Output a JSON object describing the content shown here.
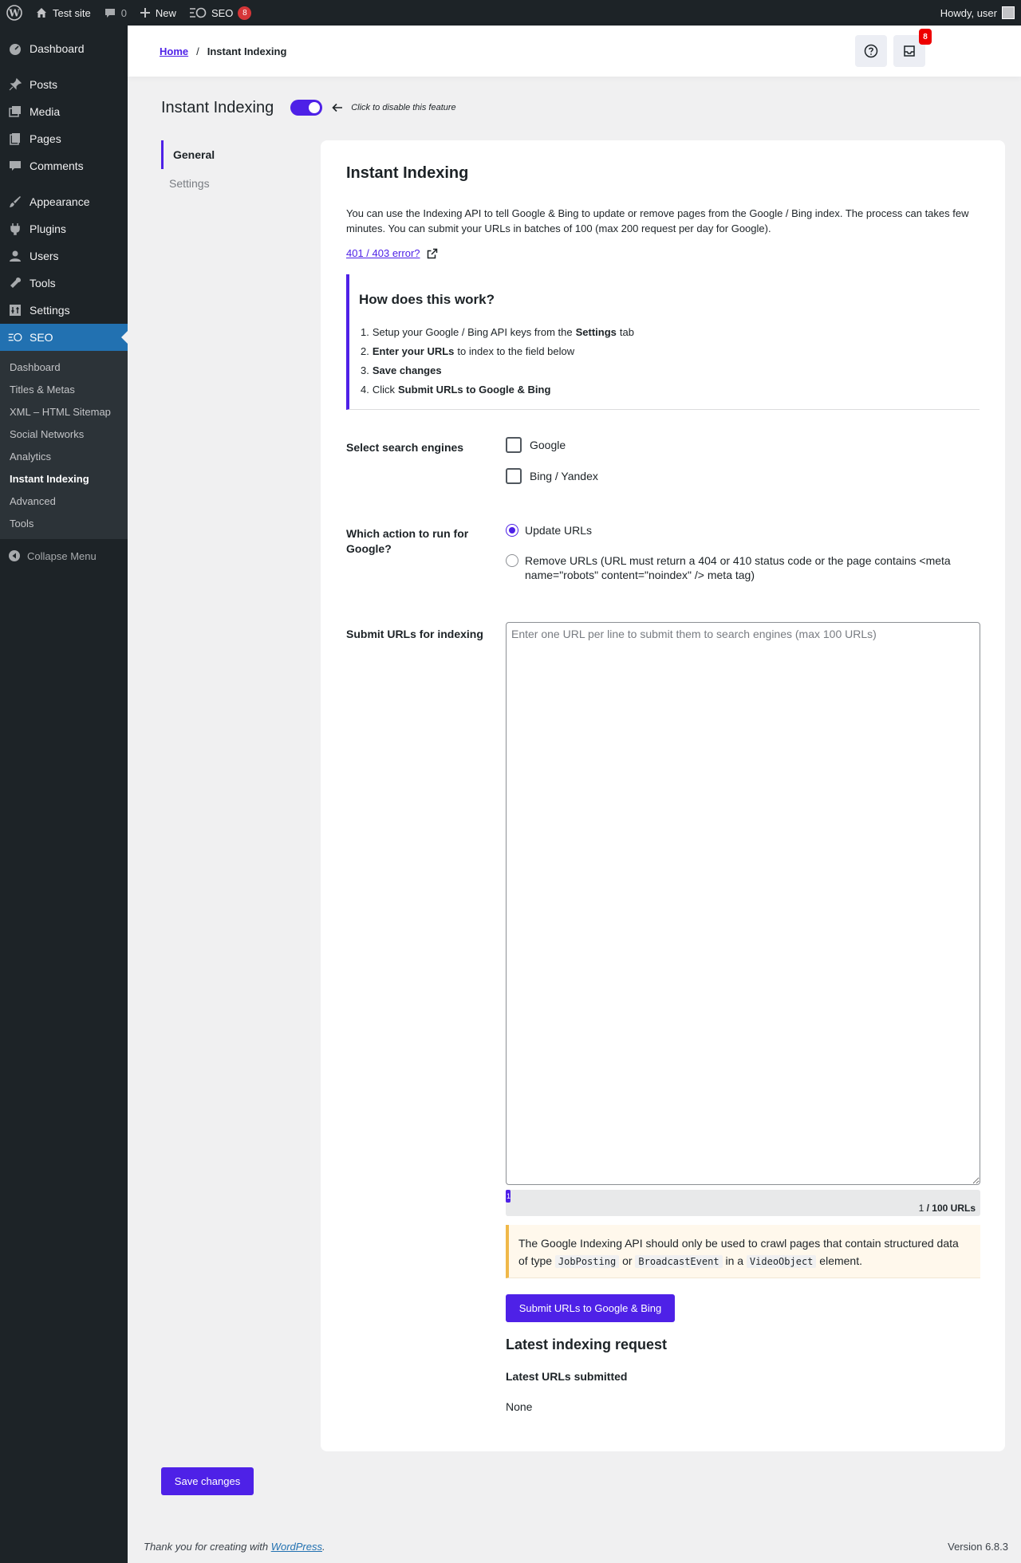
{
  "adminbar": {
    "site_name": "Test site",
    "comments_count": "0",
    "new_label": "New",
    "seo_label": "SEO",
    "seo_badge": "8",
    "howdy": "Howdy, user"
  },
  "sidebar": {
    "items": [
      {
        "label": "Dashboard",
        "icon": "dashboard-icon"
      },
      {
        "label": "Posts",
        "icon": "pin-icon"
      },
      {
        "label": "Media",
        "icon": "media-icon"
      },
      {
        "label": "Pages",
        "icon": "pages-icon"
      },
      {
        "label": "Comments",
        "icon": "comment-icon"
      },
      {
        "label": "Appearance",
        "icon": "brush-icon"
      },
      {
        "label": "Plugins",
        "icon": "plugin-icon"
      },
      {
        "label": "Users",
        "icon": "user-icon"
      },
      {
        "label": "Tools",
        "icon": "wrench-icon"
      },
      {
        "label": "Settings",
        "icon": "settings-icon"
      },
      {
        "label": "SEO",
        "icon": "seo-icon"
      }
    ],
    "submenu": [
      "Dashboard",
      "Titles & Metas",
      "XML – HTML Sitemap",
      "Social Networks",
      "Analytics",
      "Instant Indexing",
      "Advanced",
      "Tools"
    ],
    "collapse": "Collapse Menu"
  },
  "header": {
    "breadcrumb_home": "Home",
    "breadcrumb_sep": "/",
    "breadcrumb_current": "Instant Indexing",
    "notifications_badge": "8"
  },
  "feature": {
    "title": "Instant Indexing",
    "hint": "Click to disable this feature",
    "enabled": true
  },
  "tabs": [
    "General",
    "Settings"
  ],
  "card": {
    "title": "Instant Indexing",
    "description": "You can use the Indexing API to tell Google & Bing to update or remove pages from the Google / Bing index. The process can takes few minutes. You can submit your URLs in batches of 100 (max 200 request per day for Google).",
    "error_link": "401 / 403 error?",
    "howto_title": "How does this work?",
    "howto_steps": [
      {
        "num": "1.",
        "pre": "Setup your Google / Bing API keys from the",
        "bold": "Settings",
        "post": "tab"
      },
      {
        "num": "2.",
        "pre": "",
        "bold": "Enter your URLs",
        "post": "to index to the field below"
      },
      {
        "num": "3.",
        "pre": "",
        "bold": "Save changes",
        "post": ""
      },
      {
        "num": "4.",
        "pre": "Click",
        "bold": "Submit URLs to Google & Bing",
        "post": ""
      }
    ],
    "engines_label": "Select search engines",
    "engine_google": "Google",
    "engine_bing": "Bing / Yandex",
    "action_label": "Which action to run for Google?",
    "action_update": "Update URLs",
    "action_remove": "Remove URLs (URL must return a 404 or 410 status code or the page contains <meta name=\"robots\" content=\"noindex\" /> meta tag)",
    "submit_label": "Submit URLs for indexing",
    "urls_placeholder": "Enter one URL per line to submit them to search engines (max 100 URLs)",
    "progress_value": "1",
    "progress_fraction": 0.01,
    "progress_count": "1",
    "progress_max": "/ 100 URLs",
    "notice_pre": "The Google Indexing API should only be used to crawl pages that contain structured data of type",
    "notice_code1": "JobPosting",
    "notice_or": "or",
    "notice_code2": "BroadcastEvent",
    "notice_in": "in a",
    "notice_code3": "VideoObject",
    "notice_post": "element.",
    "submit_button": "Submit URLs to Google & Bing",
    "latest_title": "Latest indexing request",
    "latest_sub": "Latest URLs submitted",
    "latest_value": "None"
  },
  "save_button": "Save changes",
  "footer": {
    "thanks_pre": "Thank you for creating with",
    "thanks_link": "WordPress",
    "thanks_post": ".",
    "version": "Version 6.8.3"
  },
  "colors": {
    "accent": "#4e21e7",
    "wp_dark": "#1d2327",
    "wp_blue": "#2271b1",
    "badge_red": "#d63638",
    "notice_border": "#f0b849"
  }
}
